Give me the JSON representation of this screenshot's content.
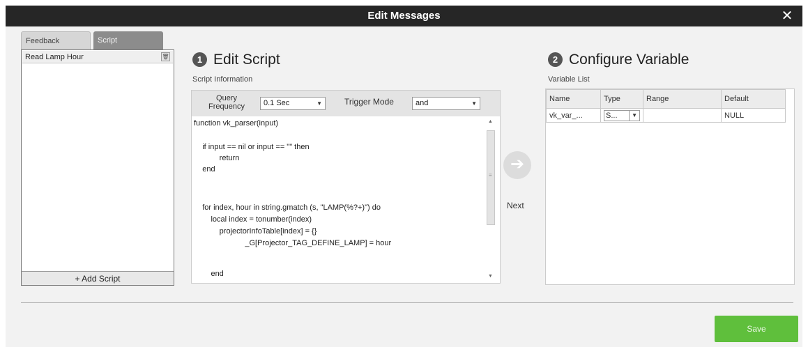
{
  "window": {
    "title": "Edit Messages",
    "close_glyph": "✕"
  },
  "left_panel": {
    "tabs": [
      {
        "label": "Feedback"
      },
      {
        "label": "Script"
      }
    ],
    "scripts": [
      {
        "label": "Read Lamp Hour"
      }
    ],
    "add_script_label": "+ Add Script"
  },
  "edit_script": {
    "step_number": "1",
    "title": "Edit Script",
    "section_label": "Script Information",
    "query_frequency_label": "Query Frequency",
    "query_frequency_value": "0.1 Sec",
    "trigger_mode_label": "Trigger Mode",
    "trigger_mode_value": "and",
    "code_lines": [
      "function vk_parser(input)",
      "",
      "    if input == nil or input == \"\" then",
      "            return",
      "    end",
      "",
      "",
      "    for index, hour in string.gmatch (s, \"LAMP(%?+)\") do",
      "        local index = tonumber(index)",
      "            projectorInfoTable[index] = {}",
      "                        _G[Projector_TAG_DEFINE_LAMP] = hour",
      "",
      "",
      "        end"
    ]
  },
  "next": {
    "label": "Next",
    "icon": "arrow-right-icon"
  },
  "configure_variable": {
    "step_number": "2",
    "title": "Configure Variable",
    "section_label": "Variable List",
    "columns": [
      "Name",
      "Type",
      "Range",
      "Default"
    ],
    "rows": [
      {
        "name": "vk_var_...",
        "type": "S...",
        "range": "",
        "default": "NULL"
      }
    ]
  },
  "save_label": "Save",
  "colors": {
    "title_bar": "#262626",
    "save_button": "#5fbf3c",
    "active_tab": "#8c8c8c"
  }
}
